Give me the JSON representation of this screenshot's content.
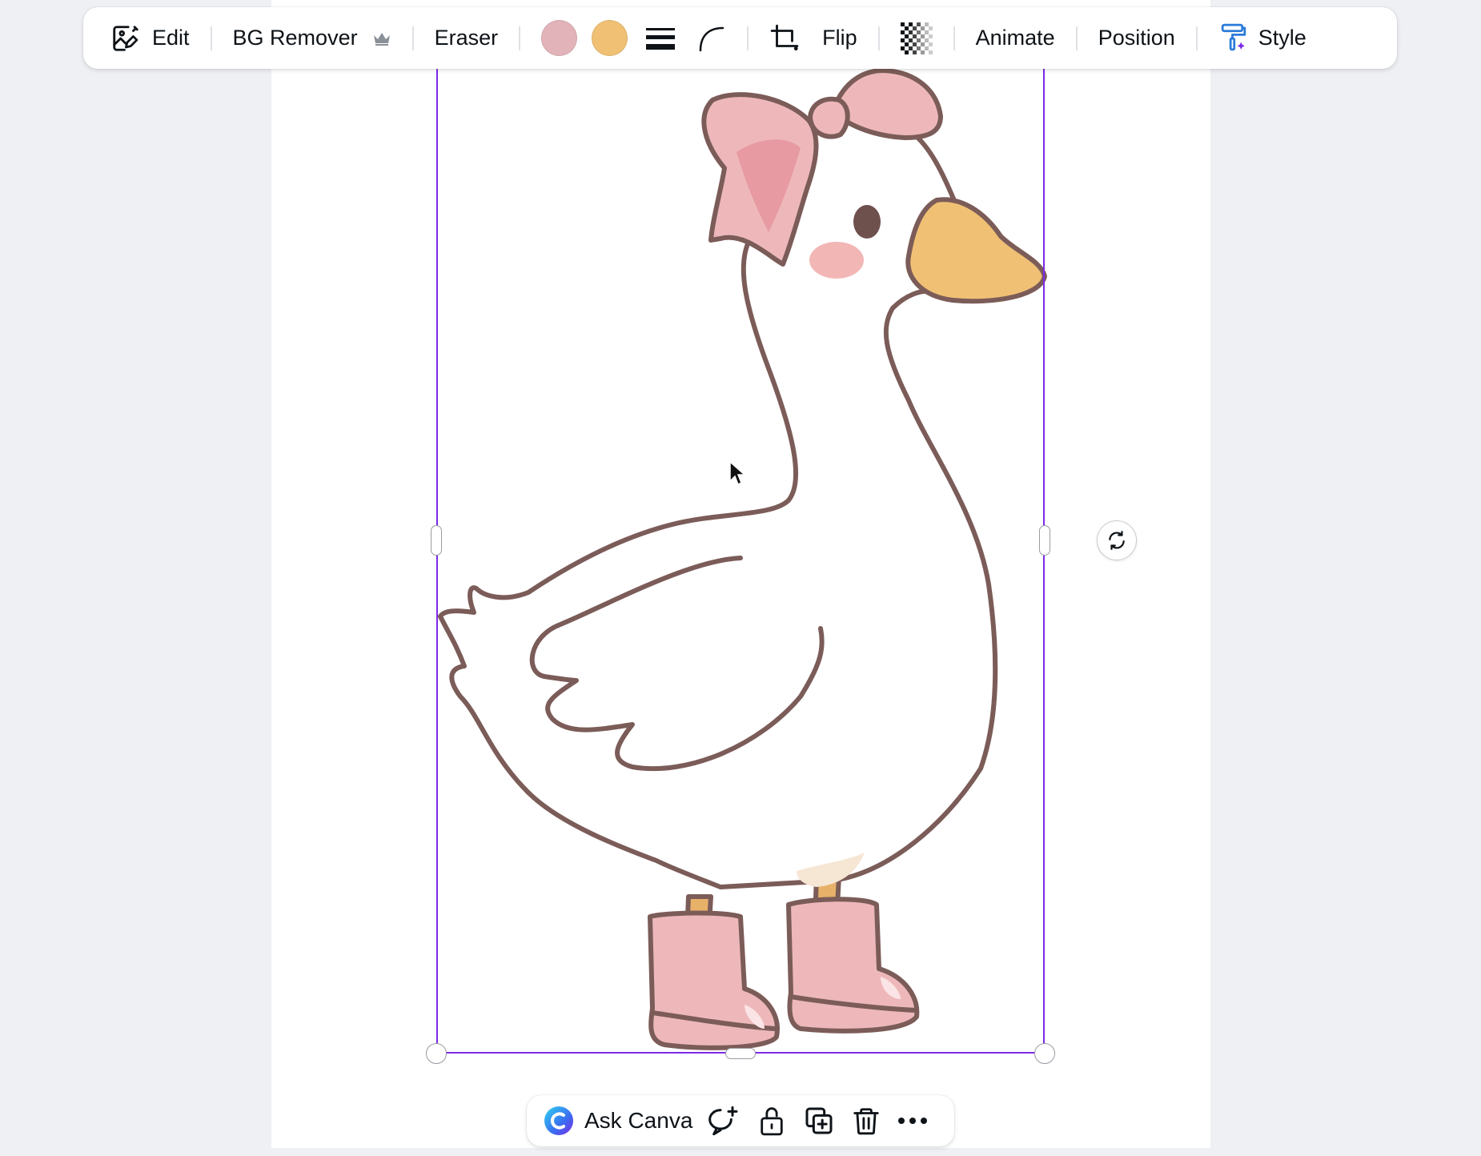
{
  "toolbar": {
    "edit_label": "Edit",
    "bg_remover_label": "BG Remover",
    "eraser_label": "Eraser",
    "flip_label": "Flip",
    "animate_label": "Animate",
    "position_label": "Position",
    "style_label": "Style",
    "swatches": [
      {
        "name": "pink-swatch",
        "color": "#e2b4b9"
      },
      {
        "name": "orange-swatch",
        "color": "#f0c074"
      }
    ],
    "icons": [
      "edit-image-icon",
      "crown-icon",
      "line-weight-icon",
      "corner-rounding-icon",
      "crop-icon",
      "transparency-icon",
      "style-brush-icon"
    ]
  },
  "bottom_bar": {
    "ask_canva_label": "Ask Canva",
    "icons": [
      "canva-assistant-icon",
      "add-comment-icon",
      "lock-icon",
      "duplicate-icon",
      "delete-icon",
      "more-icon"
    ]
  },
  "canvas": {
    "selection_color": "#7c2ae8",
    "illustration": "goose-with-pink-bow-and-boots"
  }
}
